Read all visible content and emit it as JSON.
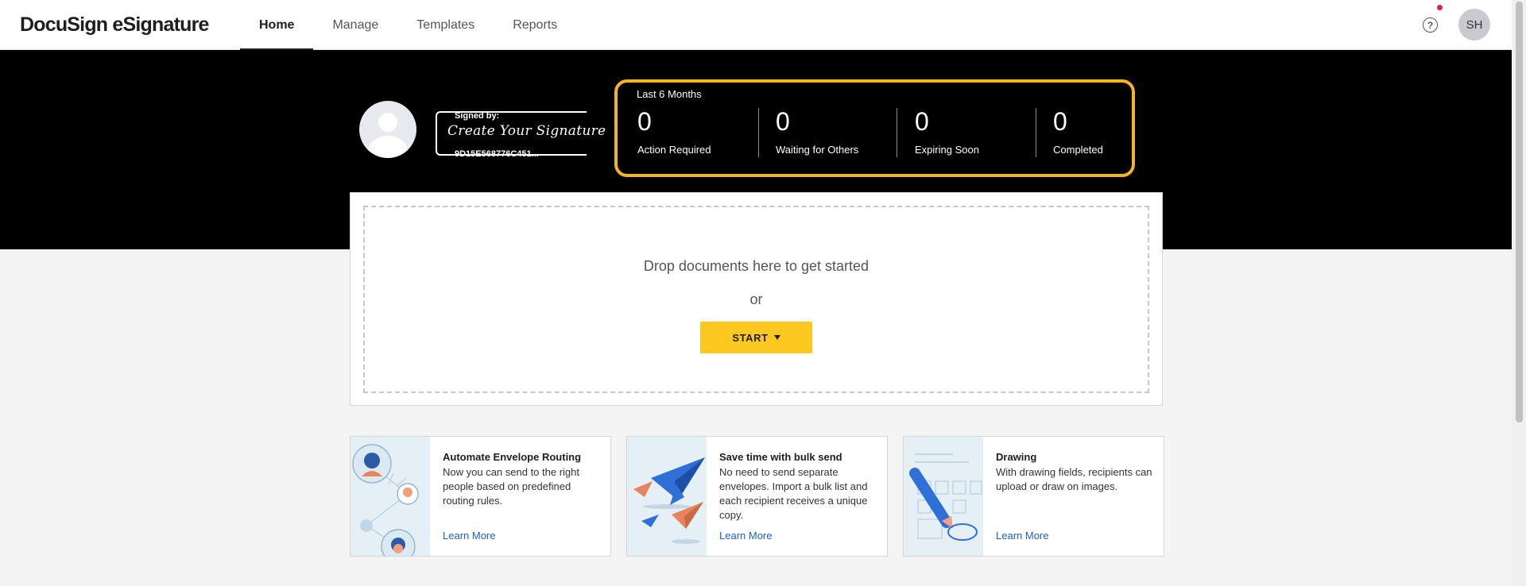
{
  "header": {
    "logo": "DocuSign eSignature",
    "tabs": [
      {
        "label": "Home",
        "active": true
      },
      {
        "label": "Manage",
        "active": false
      },
      {
        "label": "Templates",
        "active": false
      },
      {
        "label": "Reports",
        "active": false
      }
    ],
    "help_icon": "?",
    "user_initials": "SH"
  },
  "signature": {
    "signed_by_label": "Signed by:",
    "script_text": "Create Your Signature",
    "id_text": "9D15E568776C451..."
  },
  "stats": {
    "title": "Last 6 Months",
    "items": [
      {
        "value": "0",
        "label": "Action Required"
      },
      {
        "value": "0",
        "label": "Waiting for Others"
      },
      {
        "value": "0",
        "label": "Expiring Soon"
      },
      {
        "value": "0",
        "label": "Completed"
      }
    ],
    "highlight_color": "#f6b51e"
  },
  "dropzone": {
    "text": "Drop documents here to get started",
    "or_text": "or",
    "start_label": "START"
  },
  "cards": [
    {
      "title": "Automate Envelope Routing",
      "description": "Now you can send to the right people based on predefined routing rules.",
      "link": "Learn More"
    },
    {
      "title": "Save time with bulk send",
      "description": "No need to send separate envelopes. Import a bulk list and each recipient receives a unique copy.",
      "link": "Learn More"
    },
    {
      "title": "Drawing",
      "description": "With drawing fields, recipients can upload or draw on images.",
      "link": "Learn More"
    }
  ],
  "colors": {
    "accent_yellow": "#ffc820",
    "link_blue": "#1f5fcc",
    "banner_black": "#000000"
  }
}
